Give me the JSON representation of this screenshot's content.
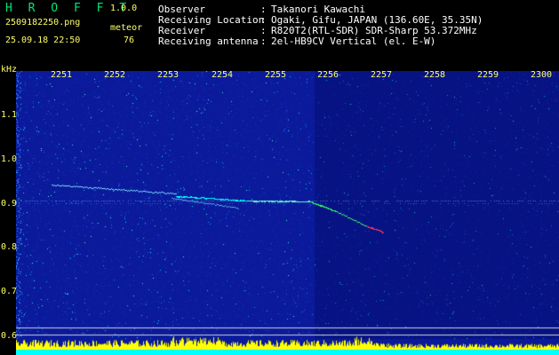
{
  "header": {
    "app_title": "H R O F F T",
    "app_version": "1.0.0",
    "filename": "2509182250.png",
    "datetime": "25.09.18 22:50",
    "meteor_label": "meteor",
    "meteor_count": "76"
  },
  "info": [
    {
      "key": "Observer",
      "value": "Takanori Kawachi"
    },
    {
      "key": "Receiving Location",
      "value": "Ogaki, Gifu, JAPAN (136.60E, 35.35N)"
    },
    {
      "key": "Receiver",
      "value": "R820T2(RTL-SDR) SDR-Sharp 53.372MHz"
    },
    {
      "key": "Receiving antenna",
      "value": "2el-HB9CV Vertical (el. E-W)"
    }
  ],
  "separator": ":",
  "axis": {
    "unit": "kHz",
    "y_ticks": [
      "1.1",
      "1.0",
      "0.9",
      "0.8",
      "0.7",
      "0.6"
    ],
    "x_ticks": [
      "2251",
      "2252",
      "2253",
      "2254",
      "2255",
      "2256",
      "2257",
      "2258",
      "2259",
      "2300"
    ]
  },
  "colors": {
    "background": "#000000",
    "noise_base": "#0a1a9a",
    "signal_cyan": "#00ffff",
    "signal_green": "#33ff66",
    "signal_red": "#ff3355",
    "level_bar": "#ffff00",
    "level_bar_bottom": "#00ffff",
    "text_green": "#00e676",
    "text_yellow": "#ffff66",
    "text_white": "#ffffff"
  }
}
